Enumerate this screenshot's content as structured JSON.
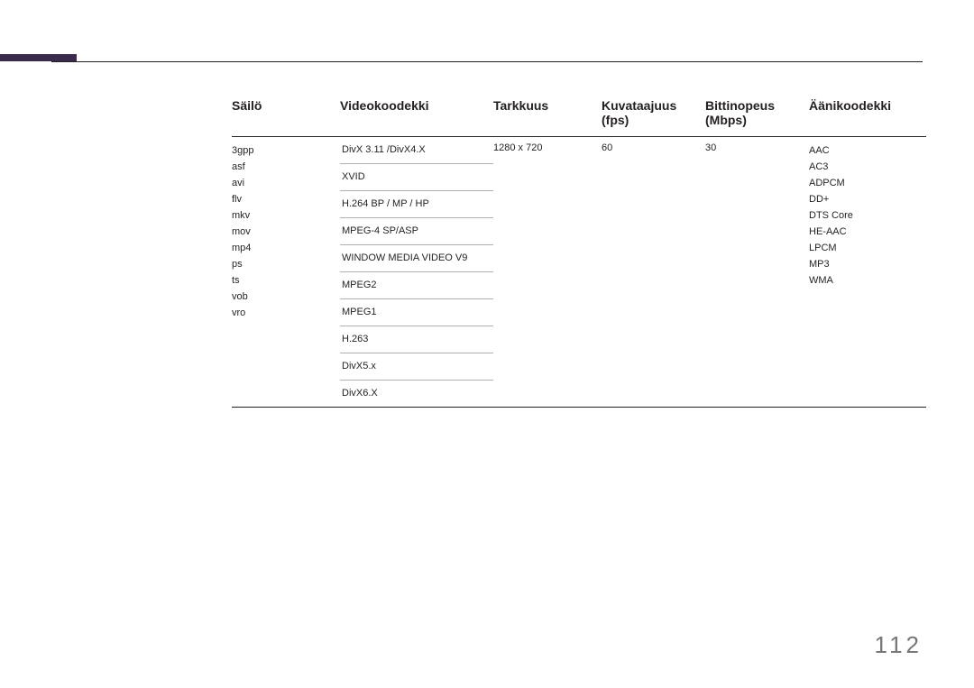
{
  "headers": {
    "container": "Säilö",
    "videocodec": "Videokoodekki",
    "resolution": "Tarkkuus",
    "framerate": "Kuvataajuus (fps)",
    "bitrate": "Bittinopeus (Mbps)",
    "audiocodec": "Äänikoodekki"
  },
  "containers": [
    "3gpp",
    "asf",
    "avi",
    "flv",
    "mkv",
    "mov",
    "mp4",
    "ps",
    "ts",
    "vob",
    "vro"
  ],
  "videocodecs": [
    "DivX 3.11 /DivX4.X",
    "XVID",
    "H.264 BP / MP / HP",
    "MPEG-4 SP/ASP",
    "WINDOW MEDIA VIDEO V9",
    "MPEG2",
    "MPEG1",
    "H.263",
    "DivX5.x",
    "DivX6.X"
  ],
  "resolution": "1280 x 720",
  "framerate": "60",
  "bitrate": "30",
  "audiocodecs": [
    "AAC",
    "AC3",
    "ADPCM",
    "DD+",
    "DTS Core",
    "HE-AAC",
    "LPCM",
    "MP3",
    "WMA"
  ],
  "page_number": "112"
}
